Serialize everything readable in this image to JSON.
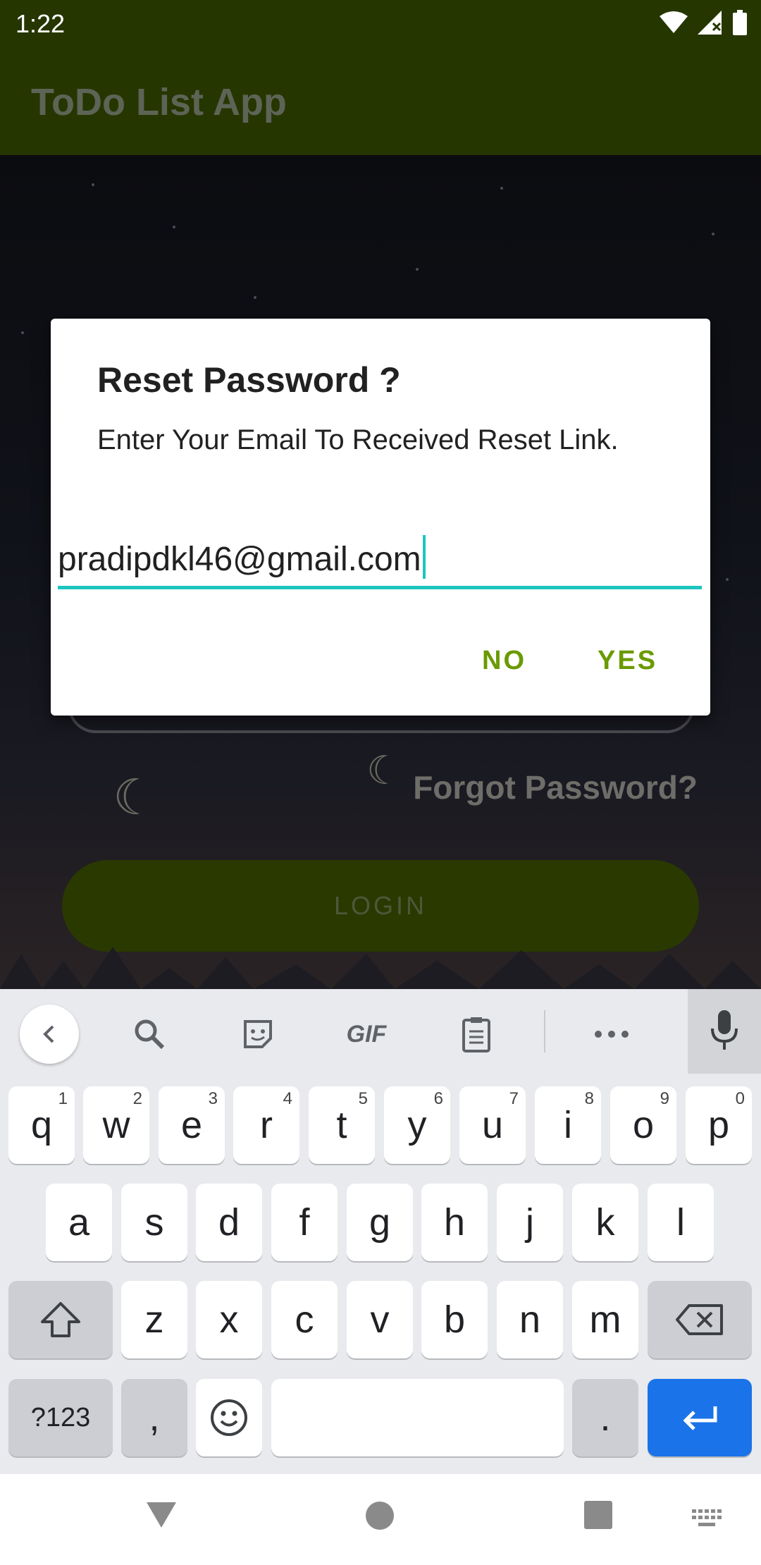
{
  "status_bar": {
    "time": "1:22"
  },
  "app_bar": {
    "title": "ToDo List App"
  },
  "background": {
    "forgot_password": "Forgot Password?",
    "login_label": "LOGIN"
  },
  "dialog": {
    "title": "Reset Password ?",
    "message": "Enter Your Email To Received Reset Link.",
    "email_value": "pradipdkl46@gmail.com",
    "no_label": "NO",
    "yes_label": "YES",
    "accent": "#1cc6bf",
    "button_color": "#6a9a00"
  },
  "keyboard": {
    "toolbar": {
      "gif_label": "GIF"
    },
    "row1": [
      {
        "key": "q",
        "hint": "1"
      },
      {
        "key": "w",
        "hint": "2"
      },
      {
        "key": "e",
        "hint": "3"
      },
      {
        "key": "r",
        "hint": "4"
      },
      {
        "key": "t",
        "hint": "5"
      },
      {
        "key": "y",
        "hint": "6"
      },
      {
        "key": "u",
        "hint": "7"
      },
      {
        "key": "i",
        "hint": "8"
      },
      {
        "key": "o",
        "hint": "9"
      },
      {
        "key": "p",
        "hint": "0"
      }
    ],
    "row2": [
      "a",
      "s",
      "d",
      "f",
      "g",
      "h",
      "j",
      "k",
      "l"
    ],
    "row3": [
      "z",
      "x",
      "c",
      "v",
      "b",
      "n",
      "m"
    ],
    "bottom": {
      "symbols": "?123",
      "comma": ",",
      "period": "."
    },
    "enter_color": "#1a73e8"
  }
}
